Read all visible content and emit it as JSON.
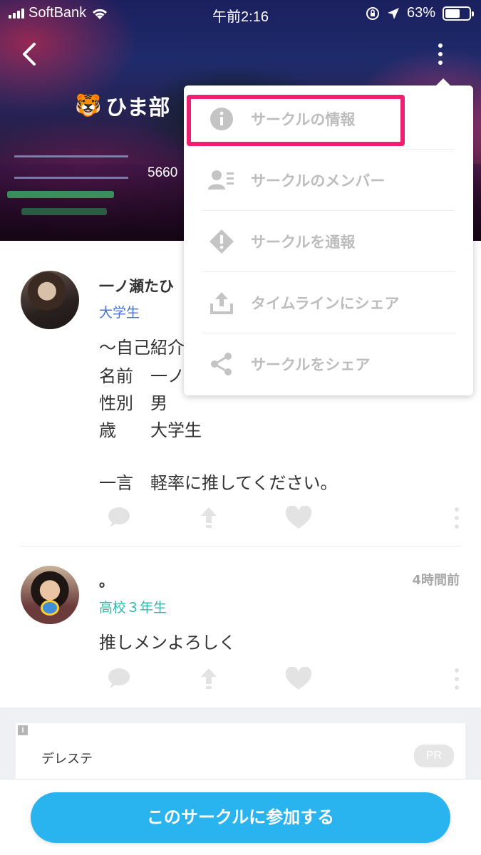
{
  "status_bar": {
    "carrier": "SoftBank",
    "time": "午前2:16",
    "battery_percent": "63%",
    "battery_level": 0.63
  },
  "header": {
    "circle_emoji": "🐯",
    "circle_title": "ひま部",
    "member_count": "5660"
  },
  "menu": {
    "items": [
      {
        "label": "サークルの情報",
        "icon": "info-icon"
      },
      {
        "label": "サークルのメンバー",
        "icon": "members-icon"
      },
      {
        "label": "サークルを通報",
        "icon": "report-icon"
      },
      {
        "label": "タイムラインにシェア",
        "icon": "upload-share-icon"
      },
      {
        "label": "サークルをシェア",
        "icon": "share-icon"
      }
    ],
    "highlighted_index": 0,
    "highlight_color": "#ee1f6e"
  },
  "posts": [
    {
      "author": "一ノ瀬たひ",
      "grade": "大学生",
      "grade_color": "#4a6fd8",
      "time_ago": "",
      "lines": [
        "〜自己紹介",
        "名前　一ノ",
        "性別　男",
        "歳　　大学生",
        "",
        "一言　軽率に推してください。"
      ]
    },
    {
      "author": "。",
      "grade": "高校３年生",
      "grade_color": "#2fb9a8",
      "time_ago": "4時間前",
      "lines": [
        "推しメンよろしく"
      ]
    }
  ],
  "ad": {
    "title": "デレステ",
    "pr_label": "PR",
    "info_glyph": "i"
  },
  "join_button": {
    "label": "このサークルに参加する",
    "color": "#29b4f0"
  },
  "icons": {
    "back": "chevron-left-icon",
    "more": "more-vertical-icon",
    "comment": "comment-icon",
    "repost": "arrow-up-icon",
    "like": "heart-icon",
    "post_more": "more-vertical-icon"
  }
}
